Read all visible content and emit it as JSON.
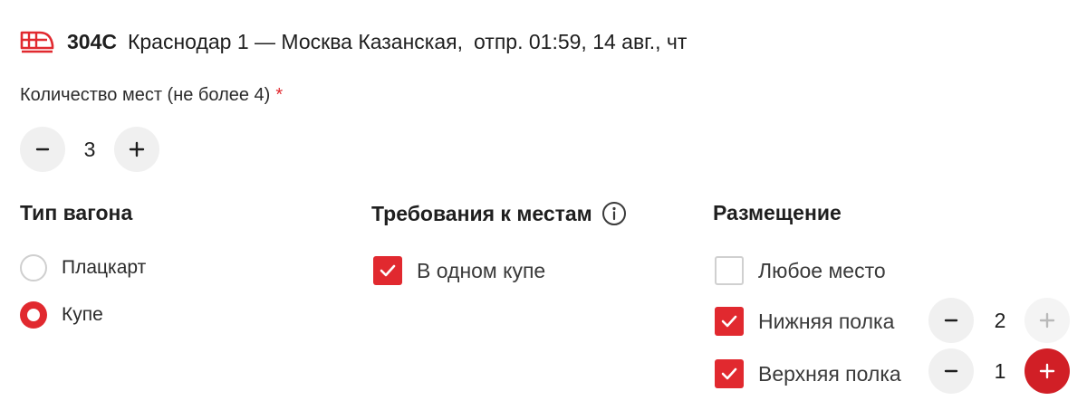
{
  "train": {
    "number": "304С",
    "route": "Краснодар 1 — Москва Казанская,",
    "departure": "отпр. 01:59, 14 авг., чт"
  },
  "seats": {
    "label": "Количество мест (не более 4)",
    "required_mark": "*",
    "count": "3",
    "minus_label": "−",
    "plus_label": "+"
  },
  "car_type": {
    "title": "Тип вагона",
    "options": [
      {
        "label": "Плацкарт",
        "selected": false
      },
      {
        "label": "Купе",
        "selected": true
      }
    ]
  },
  "requirements": {
    "title": "Требования к местам",
    "info_icon": "info-icon",
    "options": [
      {
        "label": "В одном купе",
        "checked": true
      }
    ]
  },
  "placement": {
    "title": "Размещение",
    "options": [
      {
        "label": "Любое место",
        "checked": false
      },
      {
        "label": "Нижняя полка",
        "checked": true,
        "count": "2",
        "plus_enabled": false
      },
      {
        "label": "Верхняя полка",
        "checked": true,
        "count": "1",
        "plus_enabled": true
      }
    ]
  },
  "colors": {
    "accent": "#e1292f",
    "accent_dark": "#d11f26",
    "button_bg": "#f0f0f0",
    "text": "#1f1f1f"
  }
}
